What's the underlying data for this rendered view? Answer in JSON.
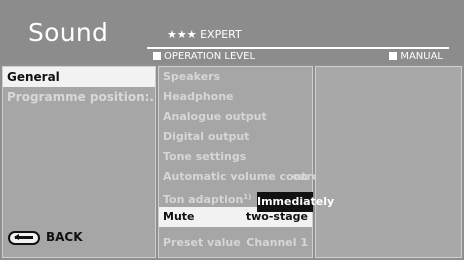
{
  "header": {
    "title": "Sound",
    "expert_label": "★★★ EXPERT",
    "operation_level_label": "OPERATION LEVEL",
    "manual_label": "MANUAL"
  },
  "left_menu": {
    "items": [
      {
        "label": "General",
        "selected": true
      },
      {
        "label": "Programme position:...",
        "selected": false
      }
    ]
  },
  "middle_menu": {
    "items": [
      {
        "label": "Speakers",
        "value": ""
      },
      {
        "label": "Headphone",
        "value": ""
      },
      {
        "label": "Analogue output",
        "value": ""
      },
      {
        "label": "Digital output",
        "value": ""
      },
      {
        "label": "Tone settings",
        "value": ""
      },
      {
        "label": "Automatic volume control",
        "value": "on"
      },
      {
        "label": "Ton adaption",
        "sup": "1)",
        "value": ""
      },
      {
        "label": "Mute",
        "value": "two-stage",
        "selected": true
      },
      {
        "label": "Preset value",
        "value": "Channel 1"
      }
    ]
  },
  "popup": {
    "text": "Immediately"
  },
  "footer": {
    "back_label": "BACK"
  },
  "colors": {
    "background": "#8c8c8c",
    "panel": "#a6a6a6",
    "selected": "#f2f2f2",
    "popup": "#111111"
  }
}
